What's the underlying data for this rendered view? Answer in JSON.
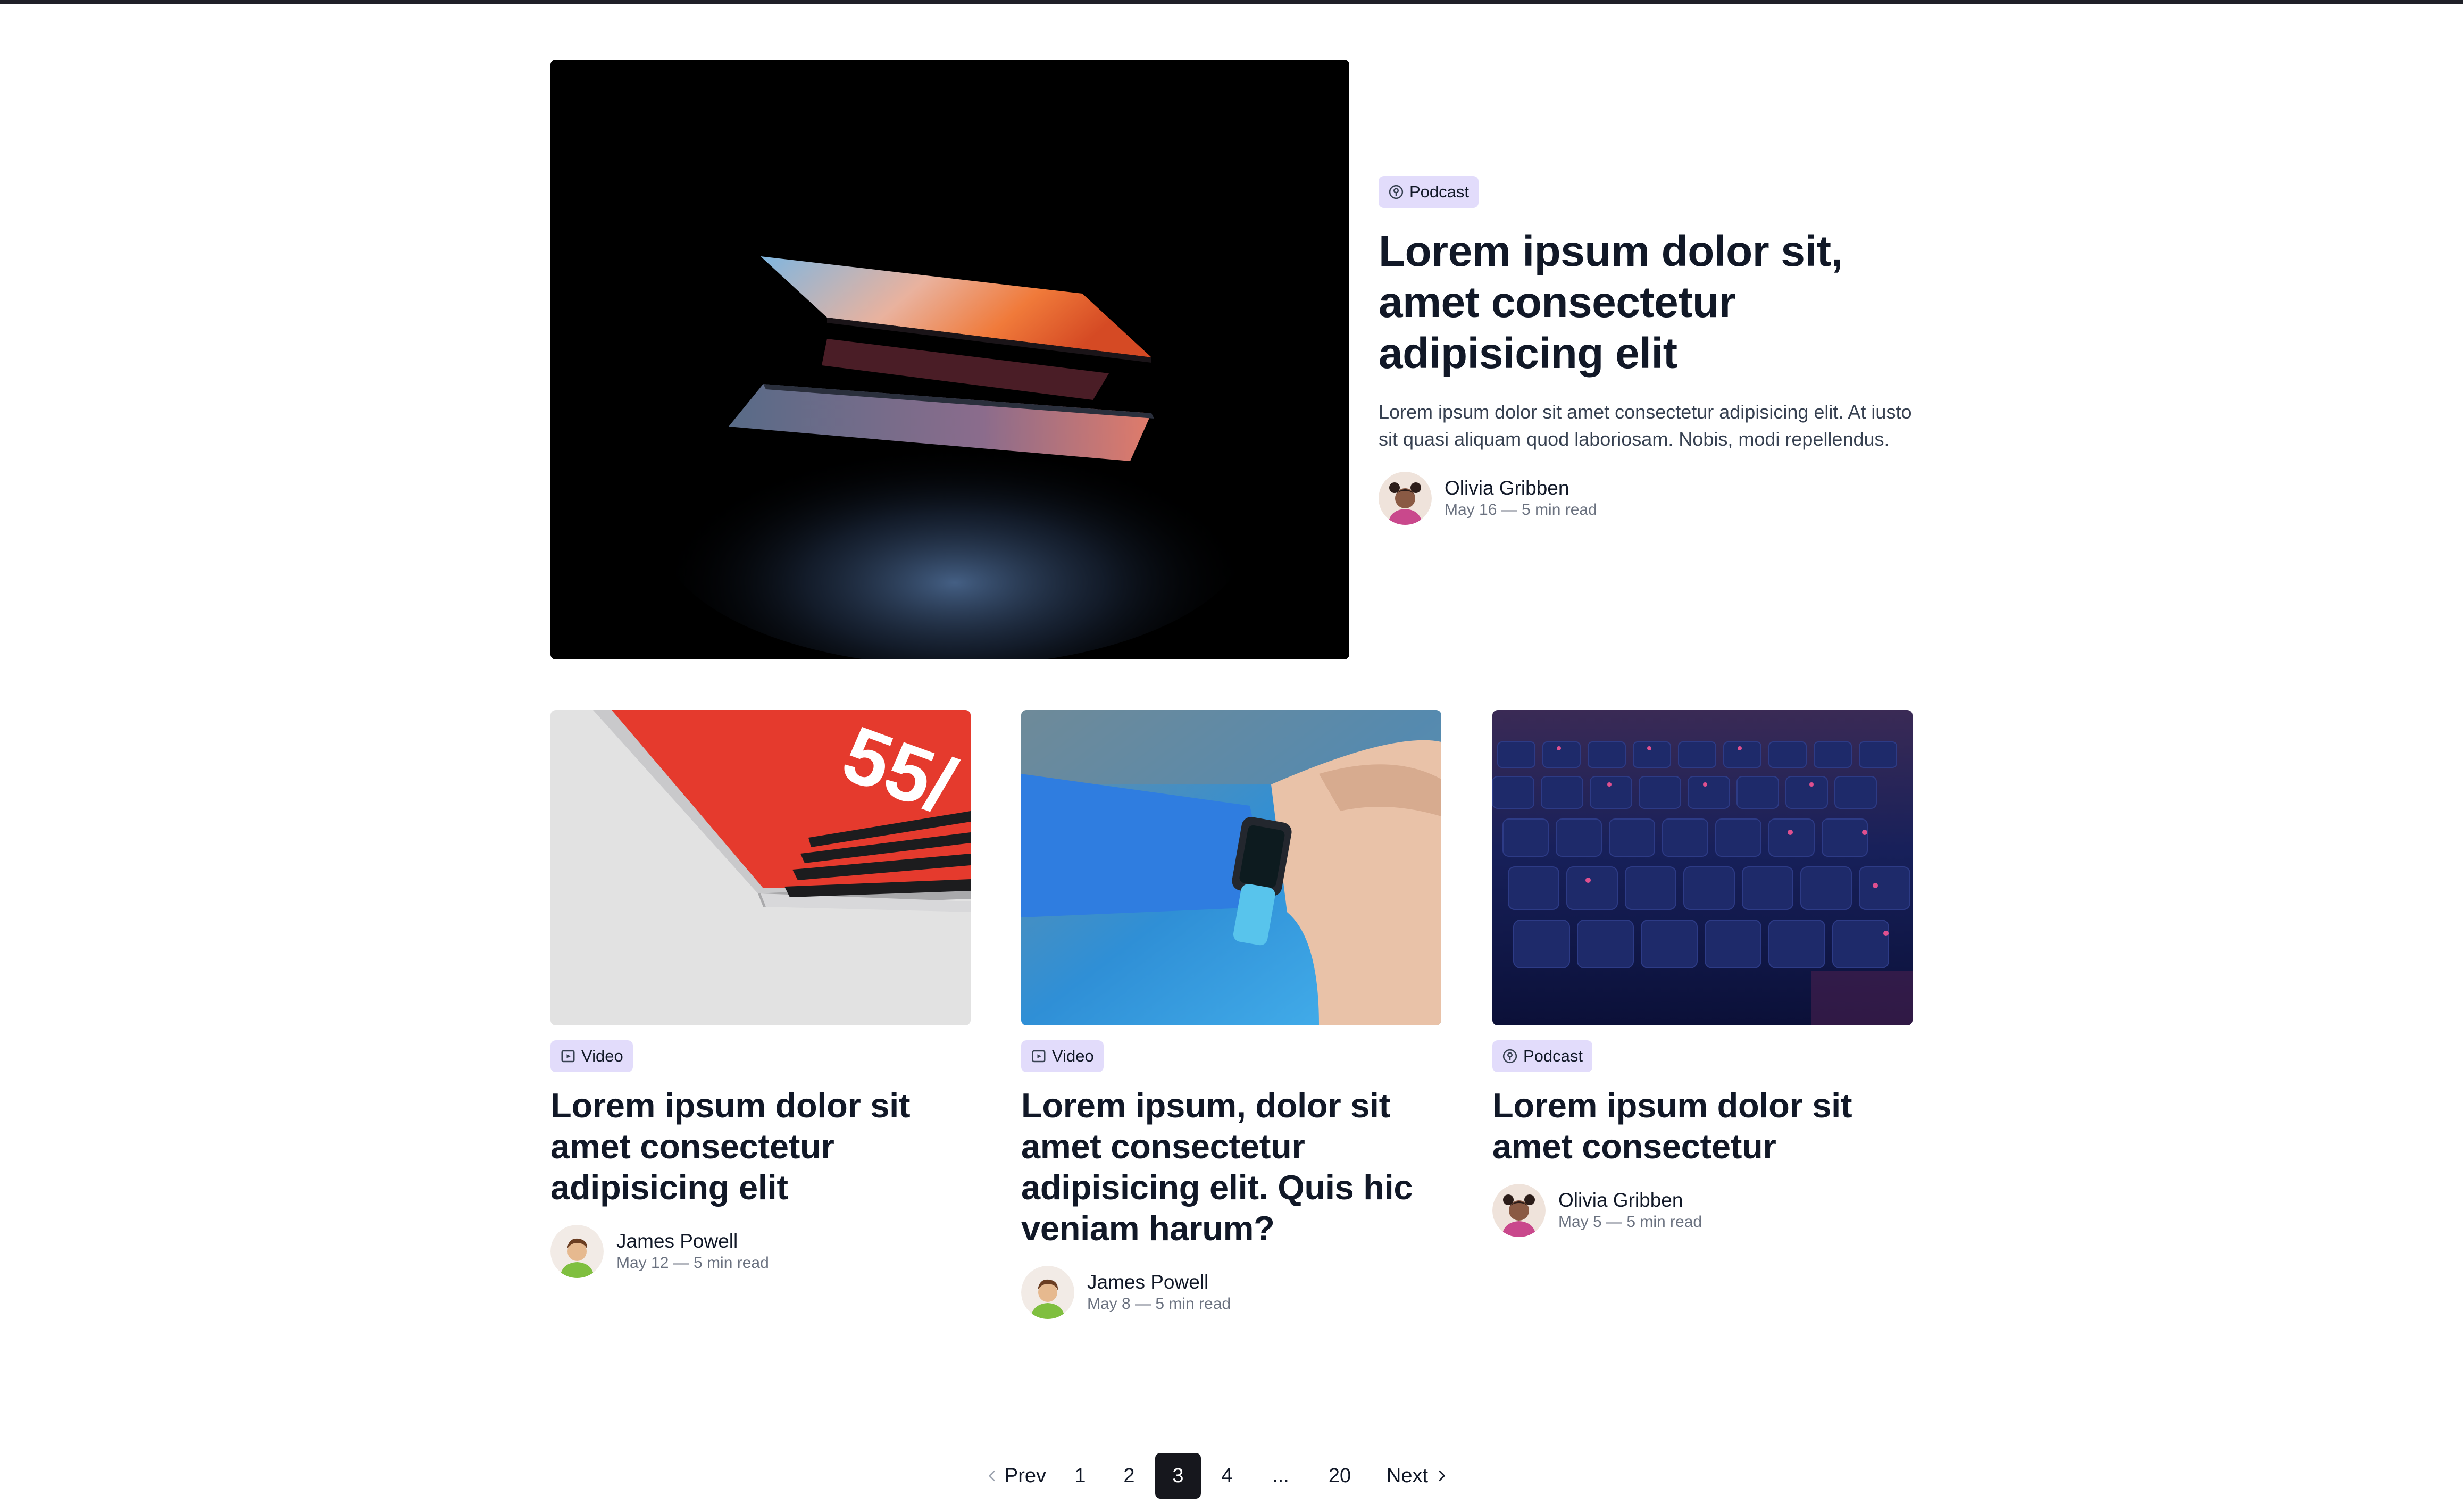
{
  "featured": {
    "badge": "Podcast",
    "title": "Lorem ipsum dolor sit, amet consectetur adipisicing elit",
    "excerpt": "Lorem ipsum dolor sit amet consectetur adipisicing elit. At iusto sit quasi aliquam quod laboriosam. Nobis, modi repellendus.",
    "author": "Olivia Gribben",
    "meta": "May 16 — 5 min read"
  },
  "posts": [
    {
      "badge": "Video",
      "title": "Lorem ipsum dolor sit amet consectetur adipisicing elit",
      "author": "James Powell",
      "meta": "May 12 — 5 min read",
      "image_text": "55/"
    },
    {
      "badge": "Video",
      "title": "Lorem ipsum, dolor sit amet consectetur adipisicing elit. Quis hic veniam harum?",
      "author": "James Powell",
      "meta": "May 8 — 5 min read"
    },
    {
      "badge": "Podcast",
      "title": "Lorem ipsum dolor sit amet consectetur",
      "author": "Olivia Gribben",
      "meta": "May 5 — 5 min read"
    }
  ],
  "pagination": {
    "prev": "Prev",
    "pages": [
      "1",
      "2",
      "3",
      "4",
      "...",
      "20"
    ],
    "current": "3",
    "next": "Next"
  },
  "colors": {
    "badge_bg": "#e2dcfb",
    "current_page_bg": "#16171d",
    "top_bar": "#1f2028"
  }
}
